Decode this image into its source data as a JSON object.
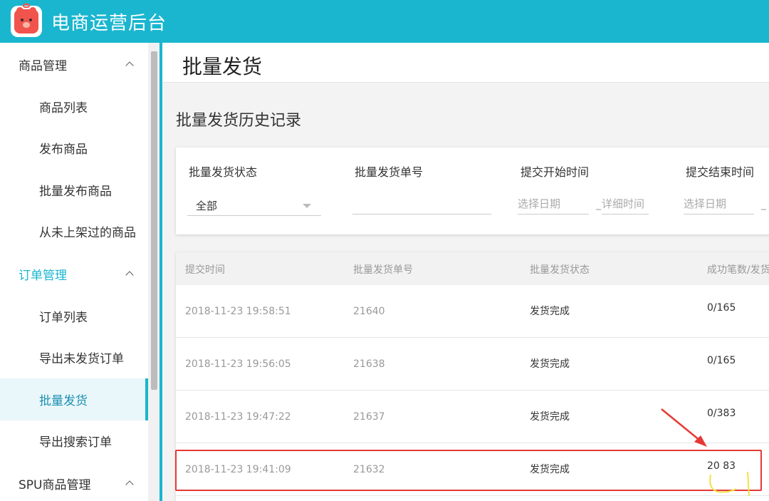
{
  "app": {
    "title": "电商运营后台"
  },
  "sidebar": {
    "groups": [
      {
        "label": "商品管理",
        "items": [
          "商品列表",
          "发布商品",
          "批量发布商品",
          "从未上架过的商品"
        ]
      },
      {
        "label": "订单管理",
        "items": [
          "订单列表",
          "导出未发货订单",
          "批量发货",
          "导出搜索订单"
        ]
      },
      {
        "label": "SPU商品管理",
        "items": []
      }
    ],
    "active_item": "批量发货"
  },
  "page": {
    "title": "批量发货",
    "section_title": "批量发货历史记录"
  },
  "filters": {
    "status": {
      "label": "批量发货状态",
      "value": "全部"
    },
    "order_no": {
      "label": "批量发货单号",
      "value": ""
    },
    "start": {
      "label": "提交开始时间",
      "date_placeholder": "选择日期",
      "time_placeholder": "详细时间",
      "sep": "_"
    },
    "end": {
      "label": "提交结束时间",
      "date_placeholder": "选择日期",
      "sep": "_"
    }
  },
  "table": {
    "headers": [
      "提交时间",
      "批量发货单号",
      "批量发货状态",
      "成功笔数/发货"
    ],
    "rows": [
      {
        "time": "2018-11-23 19:58:51",
        "no": "21640",
        "status": "发货完成",
        "count": "0/165"
      },
      {
        "time": "2018-11-23 19:56:05",
        "no": "21638",
        "status": "发货完成",
        "count": "0/165"
      },
      {
        "time": "2018-11-23 19:47:22",
        "no": "21637",
        "status": "发货完成",
        "count": "0/383"
      },
      {
        "time": "2018-11-23 19:41:09",
        "no": "21632",
        "status": "发货完成",
        "count": "20  83"
      }
    ]
  },
  "colors": {
    "brand": "#1ab6cf",
    "highlight": "#e53935"
  }
}
